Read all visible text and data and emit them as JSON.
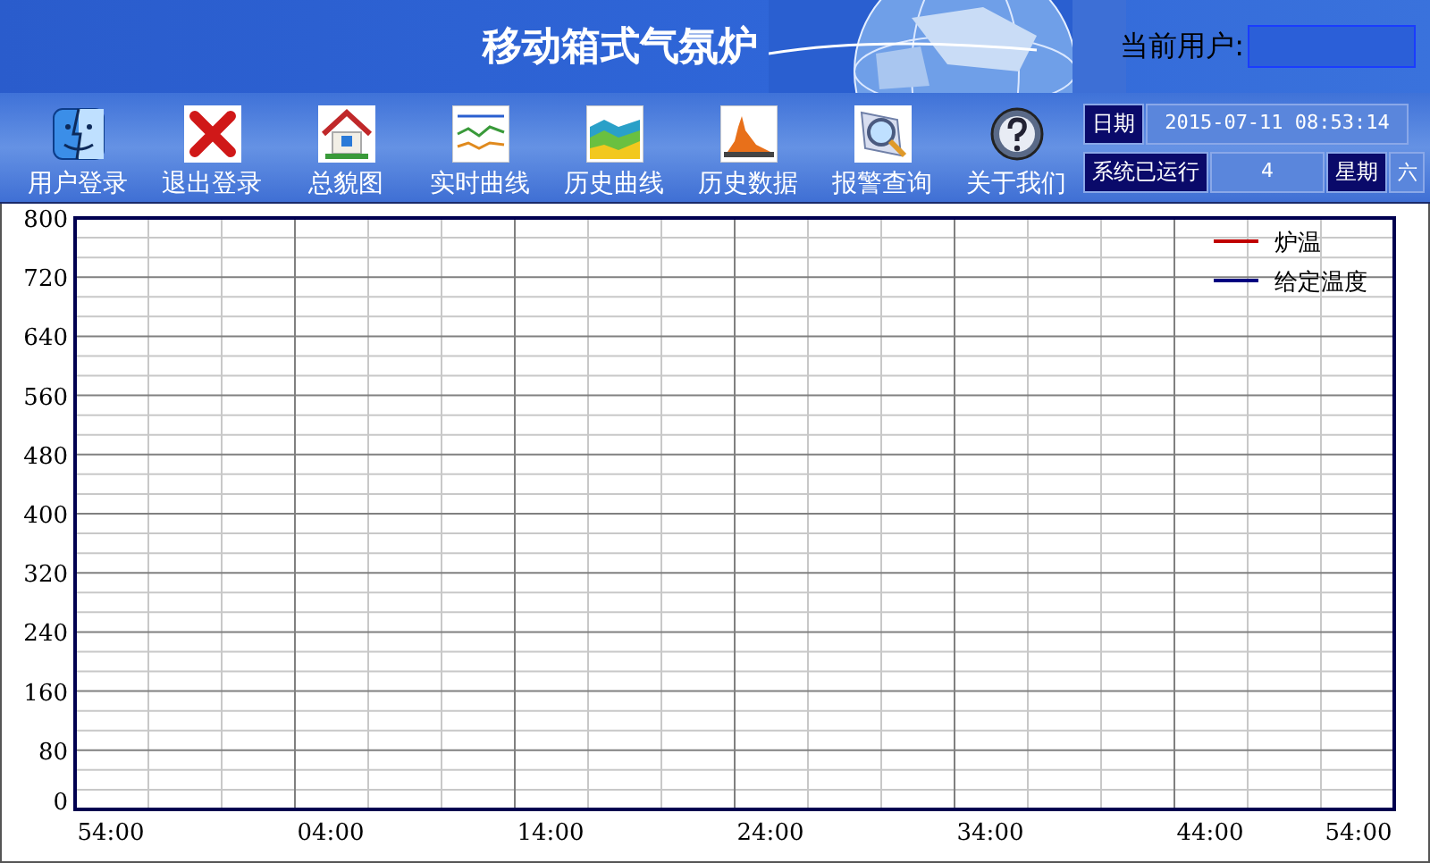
{
  "header": {
    "title": "移动箱式气氛炉",
    "user_label": "当前用户:"
  },
  "toolbar": [
    {
      "label": "用户登录"
    },
    {
      "label": "退出登录"
    },
    {
      "label": "总貌图"
    },
    {
      "label": "实时曲线"
    },
    {
      "label": "历史曲线"
    },
    {
      "label": "历史数据"
    },
    {
      "label": "报警查询"
    },
    {
      "label": "关于我们"
    }
  ],
  "status": {
    "date_label": "日期",
    "date_value": "2015-07-11 08:53:14",
    "runtime_label": "系统已运行",
    "runtime_value": "4",
    "weekday_label": "星期",
    "weekday_value": "六"
  },
  "chart_data": {
    "type": "line",
    "ylim": [
      0,
      800
    ],
    "yticks": [
      0,
      80,
      160,
      240,
      320,
      400,
      480,
      560,
      640,
      720,
      800
    ],
    "grid": true,
    "categories": [
      "54:00",
      "04:00",
      "14:00",
      "24:00",
      "34:00",
      "44:00",
      "54:00"
    ],
    "series": [
      {
        "name": "炉温",
        "color": "#c00000",
        "values": [
          null,
          null,
          null,
          null,
          null,
          null,
          null
        ]
      },
      {
        "name": "给定温度",
        "color": "#000080",
        "values": [
          null,
          null,
          null,
          null,
          null,
          null,
          null
        ]
      }
    ]
  }
}
